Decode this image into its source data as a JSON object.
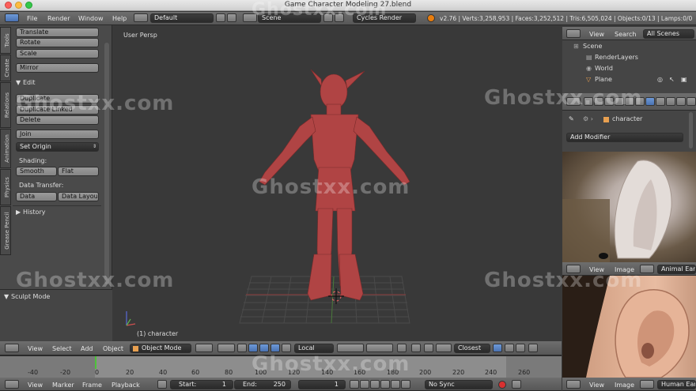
{
  "titlebar": {
    "title": "Game Character Modeling 27.blend"
  },
  "info": {
    "menus": [
      "File",
      "Render",
      "Window",
      "Help"
    ],
    "layout": "Default",
    "scene": "Scene",
    "engine": "Cycles Render",
    "stats": "v2.76 | Verts:3,258,953 | Faces:3,252,512 | Tris:6,505,024 | Objects:0/13 | Lamps:0/0"
  },
  "tool_tabs": [
    "Tools",
    "Create",
    "Relations",
    "Animation",
    "Physics",
    "Grease Pencil"
  ],
  "tools": {
    "translate": "Translate",
    "rotate": "Rotate",
    "scale": "Scale",
    "mirror": "Mirror",
    "edit_header": "Edit",
    "duplicate": "Duplicate",
    "duplicate_linked": "Duplicate Linked",
    "delete": "Delete",
    "join": "Join",
    "set_origin": "Set Origin",
    "shading_label": "Shading:",
    "smooth": "Smooth",
    "flat": "Flat",
    "data_transfer_label": "Data Transfer:",
    "data": "Data",
    "data_layout": "Data Layout",
    "history_header": "History"
  },
  "sculpt_mode": "Sculpt Mode",
  "viewport": {
    "view_name": "User Persp",
    "object_label": "(1) character"
  },
  "viewport_header": {
    "menus": [
      "View",
      "Select",
      "Add",
      "Object"
    ],
    "mode": "Object Mode",
    "pivot": "Local",
    "snap": "Closest"
  },
  "timeline": {
    "ticks": [
      "-40",
      "-20",
      "0",
      "20",
      "40",
      "60",
      "80",
      "100",
      "120",
      "140",
      "160",
      "180",
      "200",
      "220",
      "240",
      "260"
    ],
    "menus": [
      "View",
      "Marker",
      "Frame",
      "Playback"
    ],
    "start_label": "Start:",
    "start": "1",
    "end_label": "End:",
    "end": "250",
    "current": "1",
    "sync": "No Sync"
  },
  "outliner": {
    "view": "View",
    "search": "Search",
    "filter": "All Scenes",
    "items": [
      "Scene",
      "RenderLayers",
      "World",
      "Plane"
    ]
  },
  "properties": {
    "object": "character",
    "add_modifier": "Add Modifier"
  },
  "image_editor_1": {
    "view": "View",
    "image": "Image",
    "name": "Animal Ear"
  },
  "image_editor_2": {
    "view": "View",
    "image": "Image",
    "name": "Human Ear"
  },
  "watermark": "Ghostxx.com",
  "colors": {
    "accent": "#5680c2",
    "character": "#b04444",
    "background": "#3a3a3a"
  }
}
